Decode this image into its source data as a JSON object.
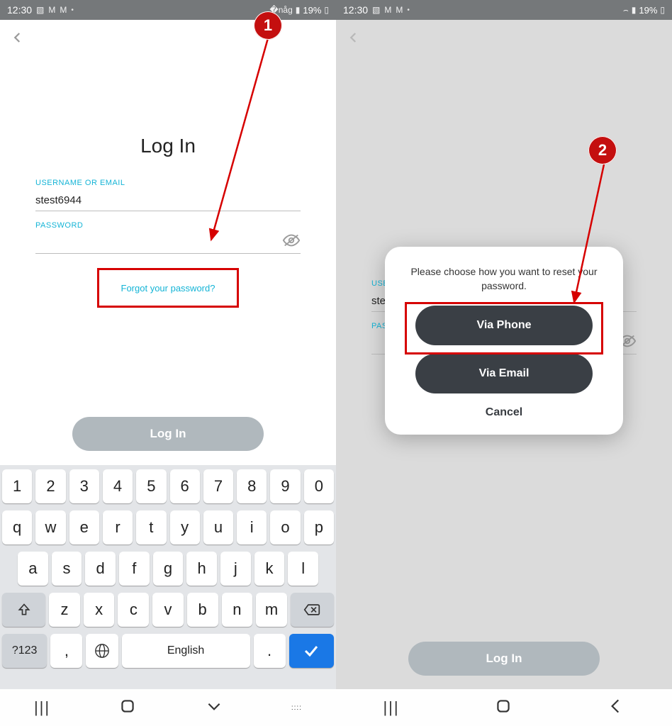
{
  "status": {
    "time": "12:30",
    "battery_pct": "19%"
  },
  "left": {
    "title": "Log In",
    "username_label": "USERNAME OR EMAIL",
    "username_value": "stest6944",
    "password_label": "PASSWORD",
    "forgot_text": "Forgot your password?",
    "login_btn": "Log In"
  },
  "keyboard": {
    "row1": [
      "1",
      "2",
      "3",
      "4",
      "5",
      "6",
      "7",
      "8",
      "9",
      "0"
    ],
    "row2": [
      "q",
      "w",
      "e",
      "r",
      "t",
      "y",
      "u",
      "i",
      "o",
      "p"
    ],
    "row3": [
      "a",
      "s",
      "d",
      "f",
      "g",
      "h",
      "j",
      "k",
      "l"
    ],
    "row4": [
      "z",
      "x",
      "c",
      "v",
      "b",
      "n",
      "m"
    ],
    "sym": "?123",
    "comma": ",",
    "space": "English",
    "period": "."
  },
  "right": {
    "username_label": "USE",
    "username_value": "ste",
    "password_label": "PAS",
    "login_btn": "Log In",
    "dialog": {
      "msg": "Please choose how you want to reset your password.",
      "phone": "Via Phone",
      "email": "Via Email",
      "cancel": "Cancel"
    }
  },
  "annotations": {
    "step1": "1",
    "step2": "2"
  }
}
